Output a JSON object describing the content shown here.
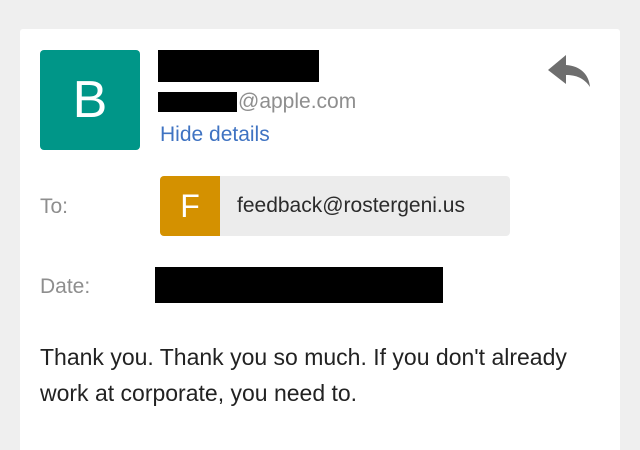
{
  "sender": {
    "avatar_letter": "B",
    "avatar_color": "#009688",
    "email_domain": "@apple.com",
    "hide_details_label": "Hide details"
  },
  "reply_icon": "reply-arrow",
  "recipients": {
    "to_label": "To:",
    "items": [
      {
        "avatar_letter": "F",
        "avatar_color": "#d49100",
        "email": "feedback@rostergeni.us"
      }
    ]
  },
  "date": {
    "label": "Date:"
  },
  "message": {
    "body": "Thank you. Thank you so much. If you don't already work at corporate, you need to."
  },
  "colors": {
    "link": "#3f73c2",
    "label_gray": "#8e8e8e",
    "chip_bg": "#ececec",
    "page_bg": "#efefef"
  }
}
